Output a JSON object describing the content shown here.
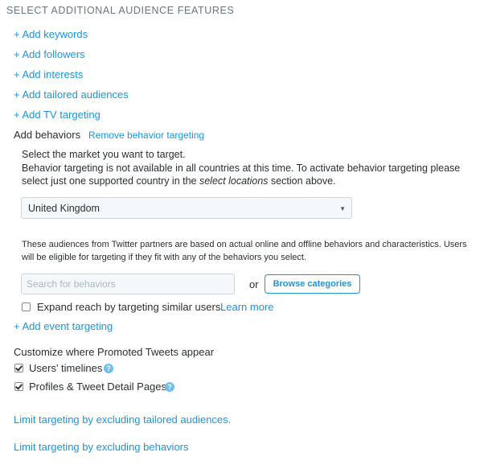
{
  "section_title": "SELECT ADDITIONAL AUDIENCE FEATURES",
  "add_links": {
    "keywords": "+ Add keywords",
    "followers": "+ Add followers",
    "interests": "+ Add interests",
    "tailored": "+ Add tailored audiences",
    "tv": "+ Add TV targeting"
  },
  "behaviors": {
    "heading": "Add behaviors",
    "remove_link": "Remove behavior targeting",
    "market_prompt": "Select the market you want to target.",
    "notice_line1": "Behavior targeting is not available in all countries at this time. To activate behavior targeting please",
    "notice_line2_pre": "select just one supported country in the ",
    "notice_line2_italic": "select locations",
    "notice_line2_post": " section above.",
    "market_value": "United Kingdom",
    "partners_line1": "These audiences from Twitter partners are based on actual online and offline behaviors and characteristics. Users",
    "partners_line2": "will be eligible for targeting if they fit with any of the behaviors you select.",
    "search_placeholder": "Search for behaviors",
    "or_text": "or",
    "browse_label": "Browse categories",
    "expand_label": "Expand reach by targeting similar users.",
    "learn_more": "Learn more",
    "expand_checked": false
  },
  "event_link": "+ Add event targeting",
  "placement": {
    "heading": "Customize where Promoted Tweets appear",
    "timelines_label": "Users' timelines",
    "timelines_checked": true,
    "profiles_label": "Profiles & Tweet Detail Pages",
    "profiles_checked": true,
    "help_glyph": "?"
  },
  "exclude": {
    "tailored": "Limit targeting by excluding tailored audiences.",
    "behaviors": "Limit targeting by excluding behaviors"
  },
  "colors": {
    "link": "#1b95e0",
    "help": "#6ec0ee"
  }
}
